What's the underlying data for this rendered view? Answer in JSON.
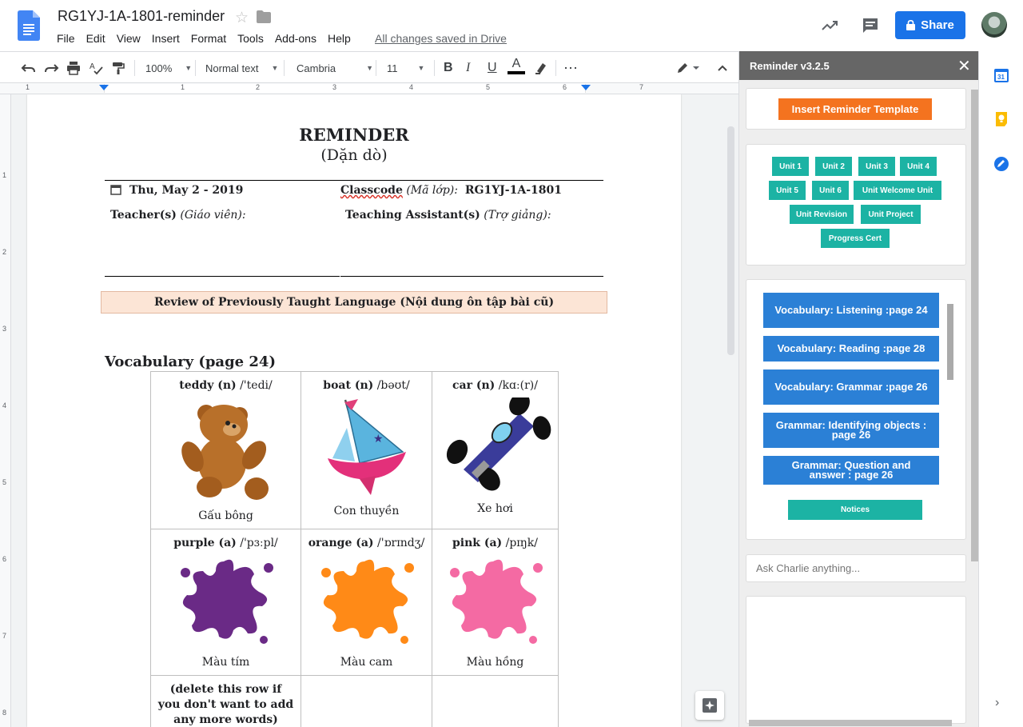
{
  "header": {
    "title": "RG1YJ-1A-1801-reminder",
    "menu": [
      "File",
      "Edit",
      "View",
      "Insert",
      "Format",
      "Tools",
      "Add-ons",
      "Help"
    ],
    "save_status": "All changes saved in Drive",
    "share_label": "Share"
  },
  "toolbar": {
    "zoom": "100%",
    "style": "Normal text",
    "font": "Cambria",
    "size": "11",
    "bold": "B",
    "italic": "I",
    "underline": "U",
    "text_color": "A"
  },
  "ruler": {
    "numbers": [
      "1",
      "1",
      "2",
      "3",
      "4",
      "5",
      "6",
      "7"
    ],
    "vnumbers": [
      "1",
      "2",
      "3",
      "4",
      "5",
      "6",
      "7",
      "8"
    ]
  },
  "doc": {
    "heading": "REMINDER",
    "subheading": "(Dặn dò)",
    "date": "Thu, May 2 - 2019",
    "classcode_label": "Classcode",
    "classcode_hint": "(Mã lớp):",
    "classcode_value": "RG1YJ-1A-1801",
    "teacher_label": "Teacher(s)",
    "teacher_hint": "(Giáo viên):",
    "ta_label": "Teaching Assistant(s)",
    "ta_hint": "(Trợ giảng):",
    "review_banner": "Review of Previously Taught Language (Nội dung ôn tập bài cũ)",
    "vocab_heading": "Vocabulary (page 24)",
    "words": [
      {
        "word": "teddy (n)",
        "ipa": "/'tedi/",
        "meaning": "Gấu bông"
      },
      {
        "word": "boat (n)",
        "ipa": "/bəʊt/",
        "meaning": "Con thuyền"
      },
      {
        "word": "car (n)",
        "ipa": "/kɑː(r)/",
        "meaning": "Xe hơi"
      },
      {
        "word": "purple (a)",
        "ipa": "/'pɜːpl/",
        "meaning": "Màu tím"
      },
      {
        "word": "orange (a)",
        "ipa": "/'ɒrɪndʒ/",
        "meaning": "Màu cam"
      },
      {
        "word": "pink (a)",
        "ipa": "/pɪŋk/",
        "meaning": "Màu hồng"
      }
    ],
    "delete_note": "(delete this row if you don't want to add any more words)"
  },
  "sidebar": {
    "title": "Reminder v3.2.5",
    "insert_template": "Insert Reminder Template",
    "units": [
      "Unit 1",
      "Unit 2",
      "Unit 3",
      "Unit 4",
      "Unit 5",
      "Unit 6",
      "Unit Welcome Unit",
      "Unit Revision",
      "Unit Project",
      "Progress Cert"
    ],
    "sections": [
      "Vocabulary: Listening :page 24",
      "Vocabulary: Reading :page 28",
      "Vocabulary: Grammar :page 26",
      "Grammar: Identifying objects : page 26",
      "Grammar: Question and answer : page 26"
    ],
    "notices": "Notices",
    "ask_placeholder": "Ask Charlie anything..."
  },
  "colors": {
    "share_blue": "#1a73e8",
    "template_orange": "#f4731f",
    "unit_teal": "#1cb3a4",
    "section_blue": "#2b80d6",
    "banner_peach": "#fce5d6"
  }
}
